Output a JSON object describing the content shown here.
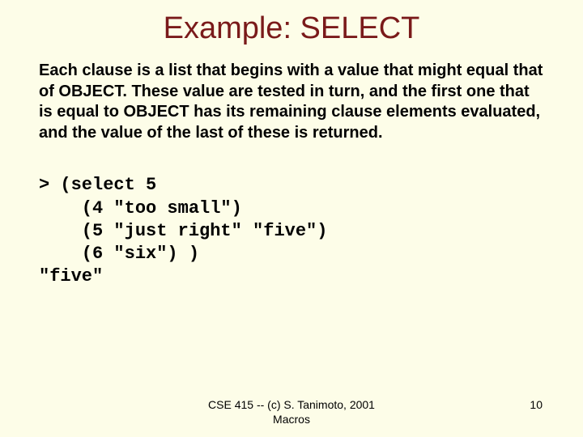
{
  "slide": {
    "title": "Example: SELECT",
    "body": "Each clause is a list that begins with a value that might equal that of OBJECT. These value are tested in turn, and the first one that is equal to OBJECT has its remaining clause elements evaluated, and the value of the last of these is returned.",
    "code": "> (select 5\n    (4 \"too small\")\n    (5 \"just right\" \"five\")\n    (6 \"six\") )\n\"five\"",
    "footer_center_line1": "CSE 415 -- (c) S. Tanimoto, 2001",
    "footer_center_line2": "Macros",
    "page_number": "10"
  }
}
